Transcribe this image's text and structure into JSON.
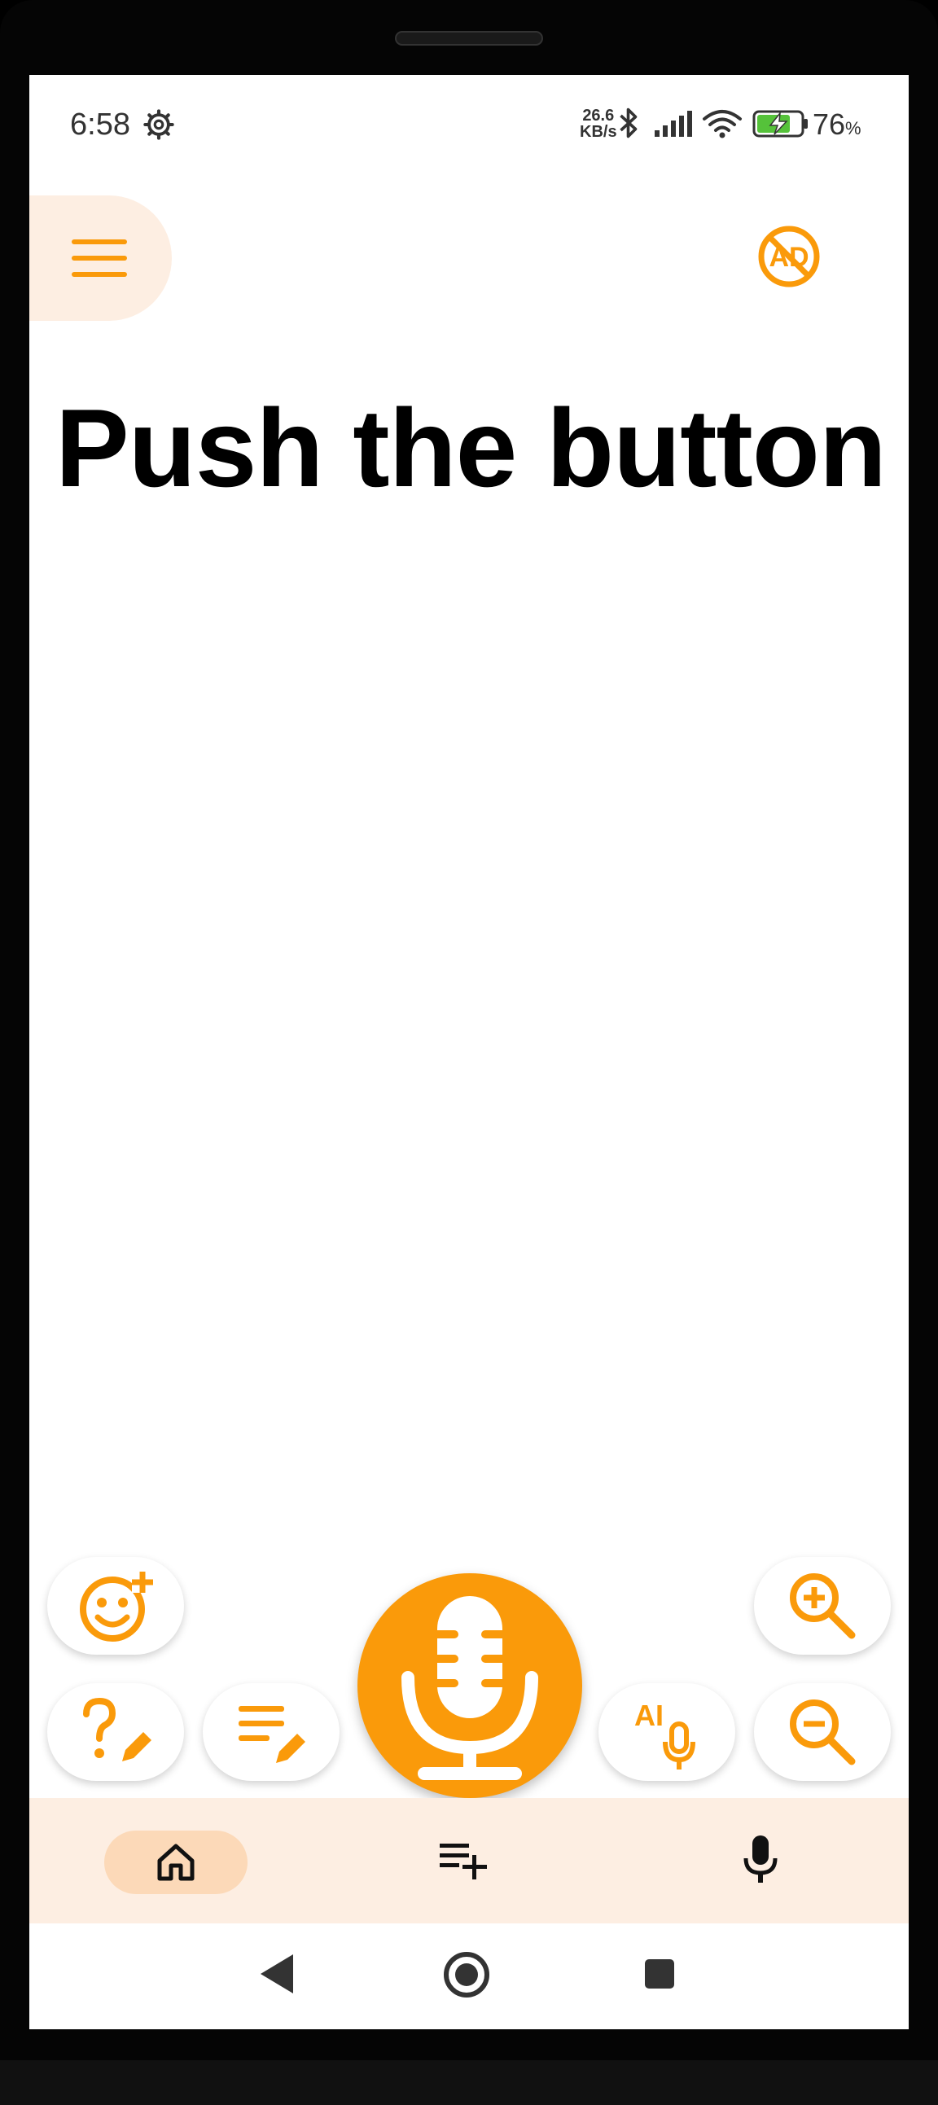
{
  "status_bar": {
    "time": "6:58",
    "net_speed_value": "26.6",
    "net_speed_unit": "KB/s",
    "battery_level": "76",
    "battery_unit": "%"
  },
  "main": {
    "headline": "Push the button"
  },
  "fab": {
    "ai_label": "AI"
  },
  "colors": {
    "accent": "#fa9a0a",
    "nav_background": "#fdeee2",
    "nav_active_pill": "#fcd9b8"
  },
  "icons": {
    "menu": "hamburger-menu-icon",
    "no_ads": "no-ads-icon",
    "add_emoji": "add-emoji-icon",
    "edit_question": "edit-question-icon",
    "edit_list": "edit-list-icon",
    "mic": "microphone-icon",
    "ai_mic": "ai-microphone-icon",
    "zoom_in": "zoom-in-icon",
    "zoom_out": "zoom-out-icon",
    "home": "home-icon",
    "playlist_add": "playlist-add-icon",
    "voice": "mic-icon"
  }
}
